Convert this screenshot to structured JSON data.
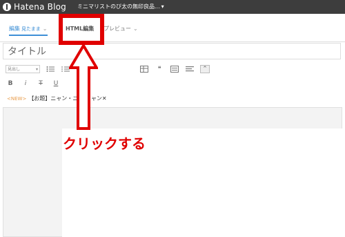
{
  "topbar": {
    "logo_text": "Hatena Blog",
    "blog_name": "ミニマリストのび太の無印良品...",
    "caret": "▾"
  },
  "tabs": {
    "edit_label": "編集",
    "edit_sub": "見たまま",
    "html_label": "HTML編集",
    "preview_label": "プレビュー",
    "chevron": "⌄"
  },
  "title_field": {
    "placeholder": "タイトル"
  },
  "toolbar": {
    "heading_select": "見出し",
    "bold": "B",
    "italic": "i",
    "strike": "T",
    "underline": "U",
    "quote": "❝",
    "caret_up": "⌃"
  },
  "tag_row": {
    "new_badge": "<NEW>",
    "text": "【お題】ニャン・ニャ  ニャン✕"
  },
  "annotation": {
    "label": "クリックする",
    "color": "#e00000"
  }
}
